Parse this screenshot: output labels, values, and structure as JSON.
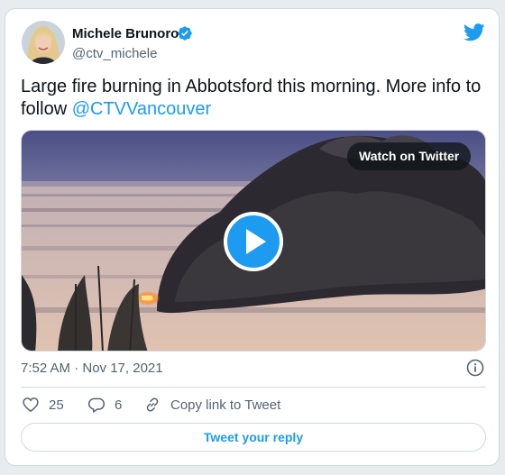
{
  "author": {
    "name": "Michele Brunoro",
    "handle": "@ctv_michele",
    "verified": true
  },
  "tweet": {
    "text": "Large fire burning in Abbotsford this morning. More info to follow ",
    "mention": "@CTVVancouver"
  },
  "media": {
    "type": "video",
    "watch_label": "Watch on Twitter"
  },
  "meta": {
    "timestamp": "7:52 AM · Nov 17, 2021"
  },
  "actions": {
    "likes": "25",
    "replies": "6",
    "copy_label": "Copy link to Tweet"
  },
  "reply_button": "Tweet your reply",
  "icons": [
    "verified-badge-icon",
    "twitter-bird-icon",
    "play-icon",
    "info-icon",
    "heart-icon",
    "reply-bubble-icon",
    "link-icon"
  ],
  "colors": {
    "accent": "#1d9bf0",
    "text": "#0f1419",
    "muted": "#536471",
    "border": "#cfd9de"
  }
}
